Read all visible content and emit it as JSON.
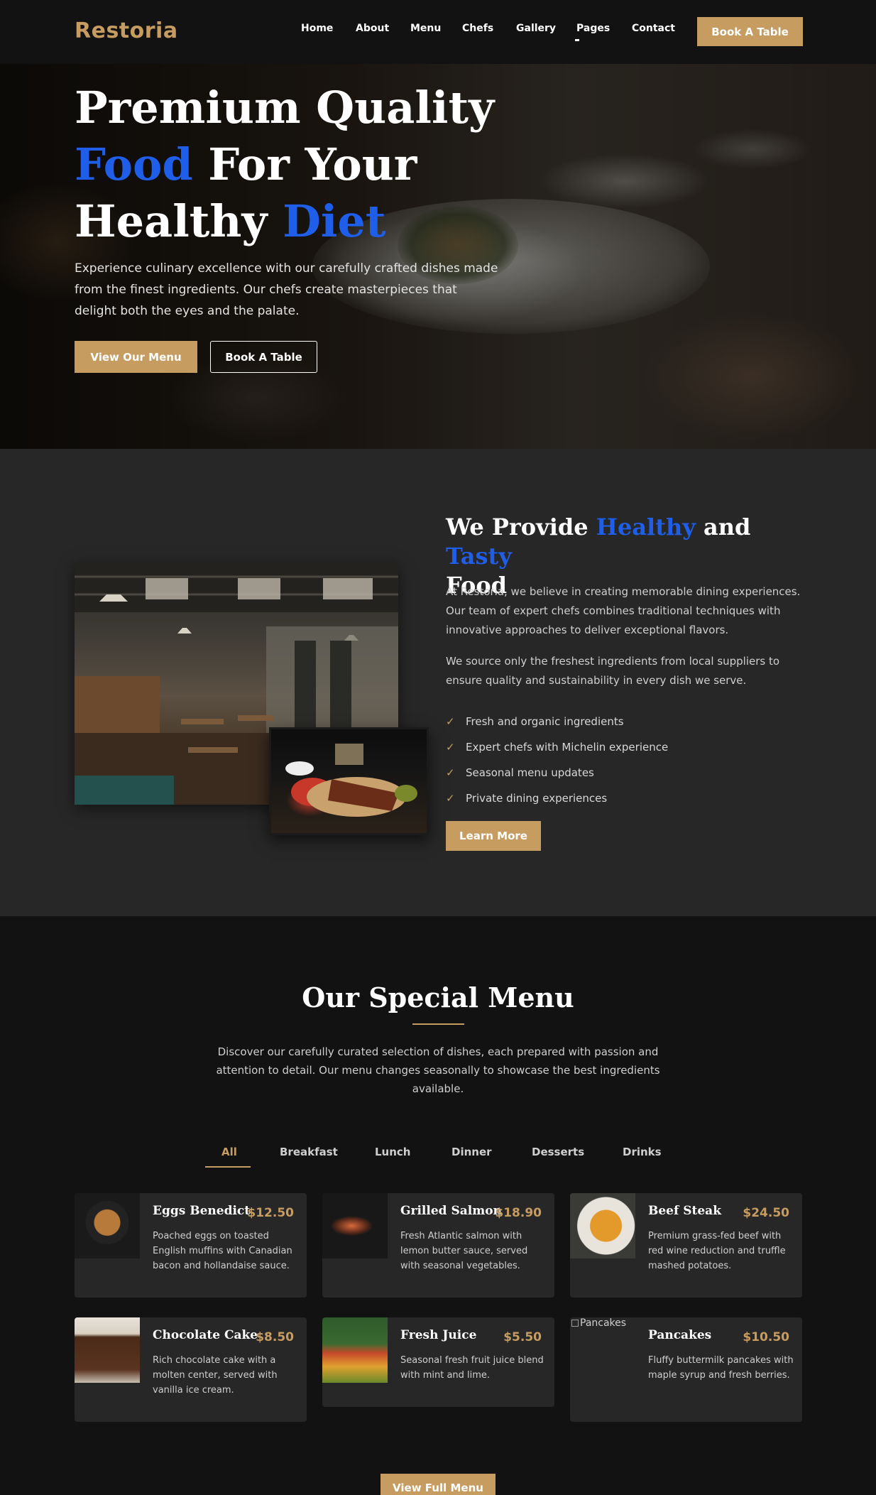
{
  "brand": {
    "name": "Restoria",
    "accent": "#c69c61",
    "highlight": "#1f5ee8"
  },
  "nav": {
    "links": [
      "Home",
      "About",
      "Menu",
      "Chefs",
      "Gallery",
      "Pages",
      "Contact"
    ],
    "cta": "Book A Table"
  },
  "hero": {
    "title_line1": "Premium Quality",
    "title_hl1": "Food",
    "title_line2_rest": " For Your",
    "title_line3": "Healthy ",
    "title_hl2": "Diet",
    "description": "Experience culinary excellence with our carefully crafted dishes made from the finest ingredients. Our chefs create masterpieces that delight both the eyes and the palate.",
    "primary_button": "View Our Menu",
    "secondary_button": "Book A Table"
  },
  "about": {
    "title_pre": "We Provide ",
    "title_hl1": "Healthy",
    "title_mid": " and ",
    "title_hl2": "Tasty",
    "title_post": "Food",
    "paragraph1": "At Restoria, we believe in creating memorable dining experiences. Our team of expert chefs combines traditional techniques with innovative approaches to deliver exceptional flavors.",
    "paragraph2": "We source only the freshest ingredients from local suppliers to ensure quality and sustainability in every dish we serve.",
    "features": [
      "Fresh and organic ingredients",
      "Expert chefs with Michelin experience",
      "Seasonal menu updates",
      "Private dining experiences"
    ],
    "button": "Learn More"
  },
  "menu": {
    "title": "Our Special Menu",
    "description": "Discover our carefully curated selection of dishes, each prepared with passion and attention to detail. Our menu changes seasonally to showcase the best ingredients available.",
    "tabs": [
      "All",
      "Breakfast",
      "Lunch",
      "Dinner",
      "Desserts",
      "Drinks"
    ],
    "active_tab": "All",
    "items": [
      {
        "name": "Eggs Benedict",
        "price": "$12.50",
        "desc": "Poached eggs on toasted English muffins with Canadian bacon and hollandaise sauce."
      },
      {
        "name": "Grilled Salmon",
        "price": "$18.90",
        "desc": "Fresh Atlantic salmon with lemon butter sauce, served with seasonal vegetables."
      },
      {
        "name": "Beef Steak",
        "price": "$24.50",
        "desc": "Premium grass-fed beef with red wine reduction and truffle mashed potatoes."
      },
      {
        "name": "Chocolate Cake",
        "price": "$8.50",
        "desc": "Rich chocolate cake with a molten center, served with vanilla ice cream."
      },
      {
        "name": "Fresh Juice",
        "price": "$5.50",
        "desc": "Seasonal fresh fruit juice blend with mint and lime."
      },
      {
        "name": "Pancakes",
        "price": "$10.50",
        "desc": "Fluffy buttermilk pancakes with maple syrup and fresh berries.",
        "image_alt": "Pancakes"
      }
    ],
    "full_button": "View Full Menu"
  }
}
